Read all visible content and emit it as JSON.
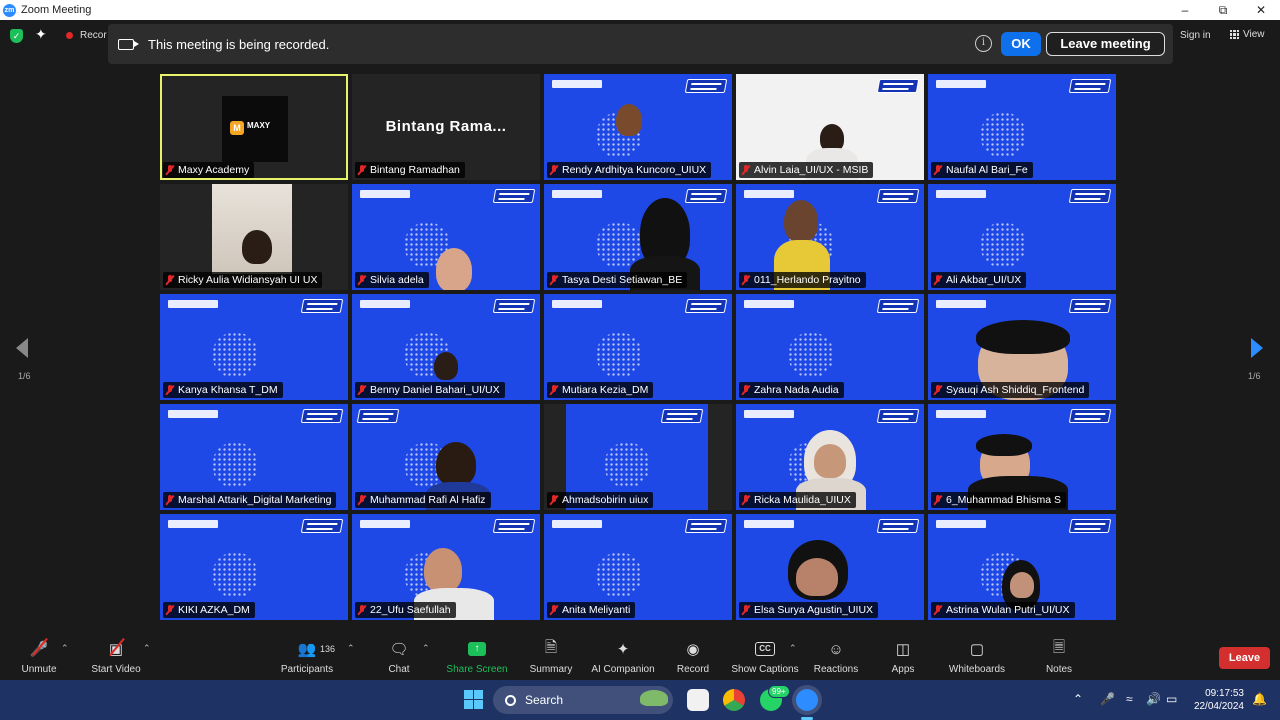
{
  "window": {
    "title": "Zoom Meeting",
    "app_logo": "zm"
  },
  "topbar": {
    "recording_label": "Recor",
    "signin": "Sign in",
    "view": "View"
  },
  "banner": {
    "text": "This meeting is being recorded.",
    "ok_label": "OK",
    "leave_label": "Leave meeting"
  },
  "participants": [
    "Maxy Academy",
    "Bintang Ramadhan",
    "Rendy Ardhitya Kuncoro_UIUX",
    "Alvin Laia_UI/UX - MSIB",
    "Naufal Al Bari_Fe",
    "Ricky Aulia Widiansyah UI UX",
    "Silvia adela",
    "Tasya Desti Setiawan_BE",
    "011_Herlando Prayitno",
    "Ali Akbar_UI/UX",
    "Kanya Khansa T_DM",
    "Benny Daniel Bahari_UI/UX",
    "Mutiara Kezia_DM",
    "Zahra Nada Audia",
    "Syauqi Ash Shiddiq_Frontend",
    "Marshal Attarik_Digital Marketing",
    "Muhammad Rafi Al Hafiz",
    "Ahmadsobirin uiux",
    "Ricka Maulida_UIUX",
    "6_Muhammad Bhisma S",
    "KIKI AZKA_DM",
    "22_Ufu Saefullah",
    "Anita Meliyanti",
    "Elsa Surya Agustin_UIUX",
    "Astrina Wulan Putri_UI/UX"
  ],
  "tile_text": {
    "bintang_big": "Bintang  Rama...",
    "maxy_mark": "M",
    "maxy_text": "MAXY"
  },
  "pagination": {
    "left": "1/6",
    "right": "1/6"
  },
  "toolbar": {
    "unmute": "Unmute",
    "start_video": "Start Video",
    "participants": "Participants",
    "participants_count": "136",
    "chat": "Chat",
    "share_screen": "Share Screen",
    "summary": "Summary",
    "ai_companion": "AI Companion",
    "record": "Record",
    "show_captions": "Show Captions",
    "cc": "CC",
    "reactions": "Reactions",
    "apps": "Apps",
    "whiteboards": "Whiteboards",
    "notes": "Notes",
    "leave": "Leave"
  },
  "taskbar": {
    "search": "Search",
    "badge": "99+",
    "time": "09:17:53",
    "date": "22/04/2024"
  }
}
